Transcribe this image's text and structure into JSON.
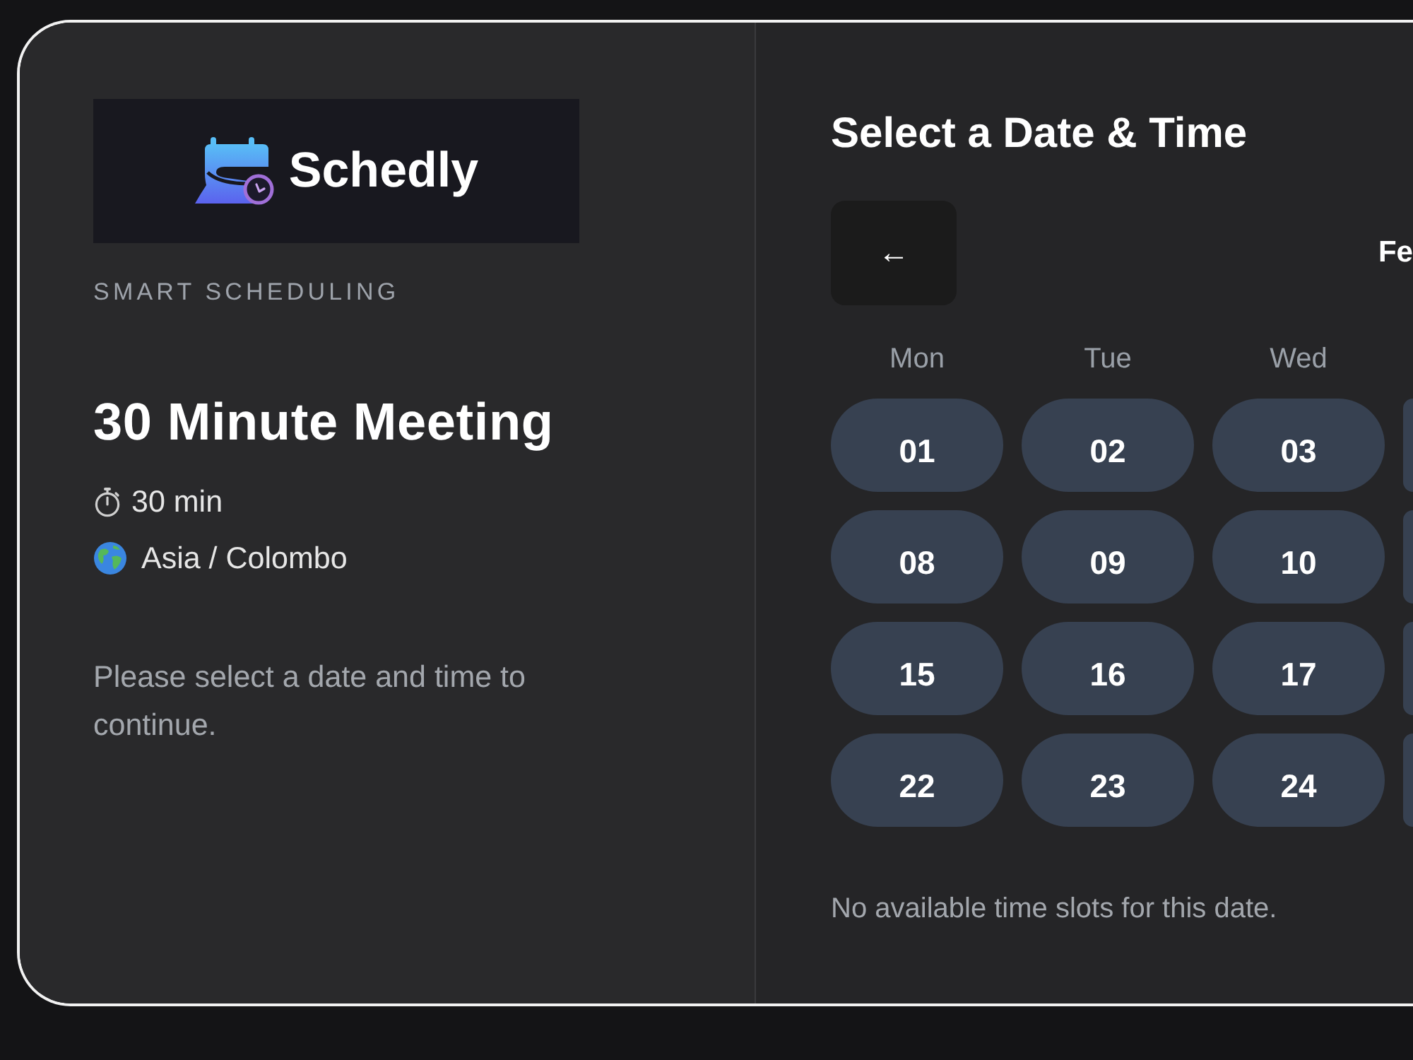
{
  "brand": {
    "name": "Schedly",
    "tagline": "SMART SCHEDULING"
  },
  "event": {
    "title": "30 Minute Meeting",
    "duration": "30 min",
    "timezone": "Asia / Colombo",
    "instruction": "Please select a date and time to continue."
  },
  "calendar": {
    "title": "Select a Date & Time",
    "prev_button": "←",
    "month": "Fe",
    "weekdays": [
      "Mon",
      "Tue",
      "Wed"
    ],
    "weeks": [
      {
        "days": [
          {
            "kind": "day",
            "label": "01",
            "selected": false
          },
          {
            "kind": "day",
            "label": "02",
            "selected": false
          },
          {
            "kind": "day",
            "label": "03",
            "selected": false
          },
          {
            "kind": "clipped"
          }
        ]
      },
      {
        "days": [
          {
            "kind": "day",
            "label": "08",
            "selected": false
          },
          {
            "kind": "day",
            "label": "09",
            "selected": false
          },
          {
            "kind": "day",
            "label": "10",
            "selected": false
          },
          {
            "kind": "clipped"
          }
        ]
      },
      {
        "days": [
          {
            "kind": "day",
            "label": "15",
            "selected": false
          },
          {
            "kind": "day",
            "label": "16",
            "selected": false
          },
          {
            "kind": "day",
            "label": "17",
            "selected": false
          },
          {
            "kind": "clipped"
          }
        ]
      },
      {
        "days": [
          {
            "kind": "day",
            "label": "22",
            "selected": false
          },
          {
            "kind": "day",
            "label": "23",
            "selected": false
          },
          {
            "kind": "day",
            "label": "24",
            "selected": false
          },
          {
            "kind": "clipped"
          }
        ]
      }
    ],
    "empty_message": "No available time slots for this date."
  }
}
